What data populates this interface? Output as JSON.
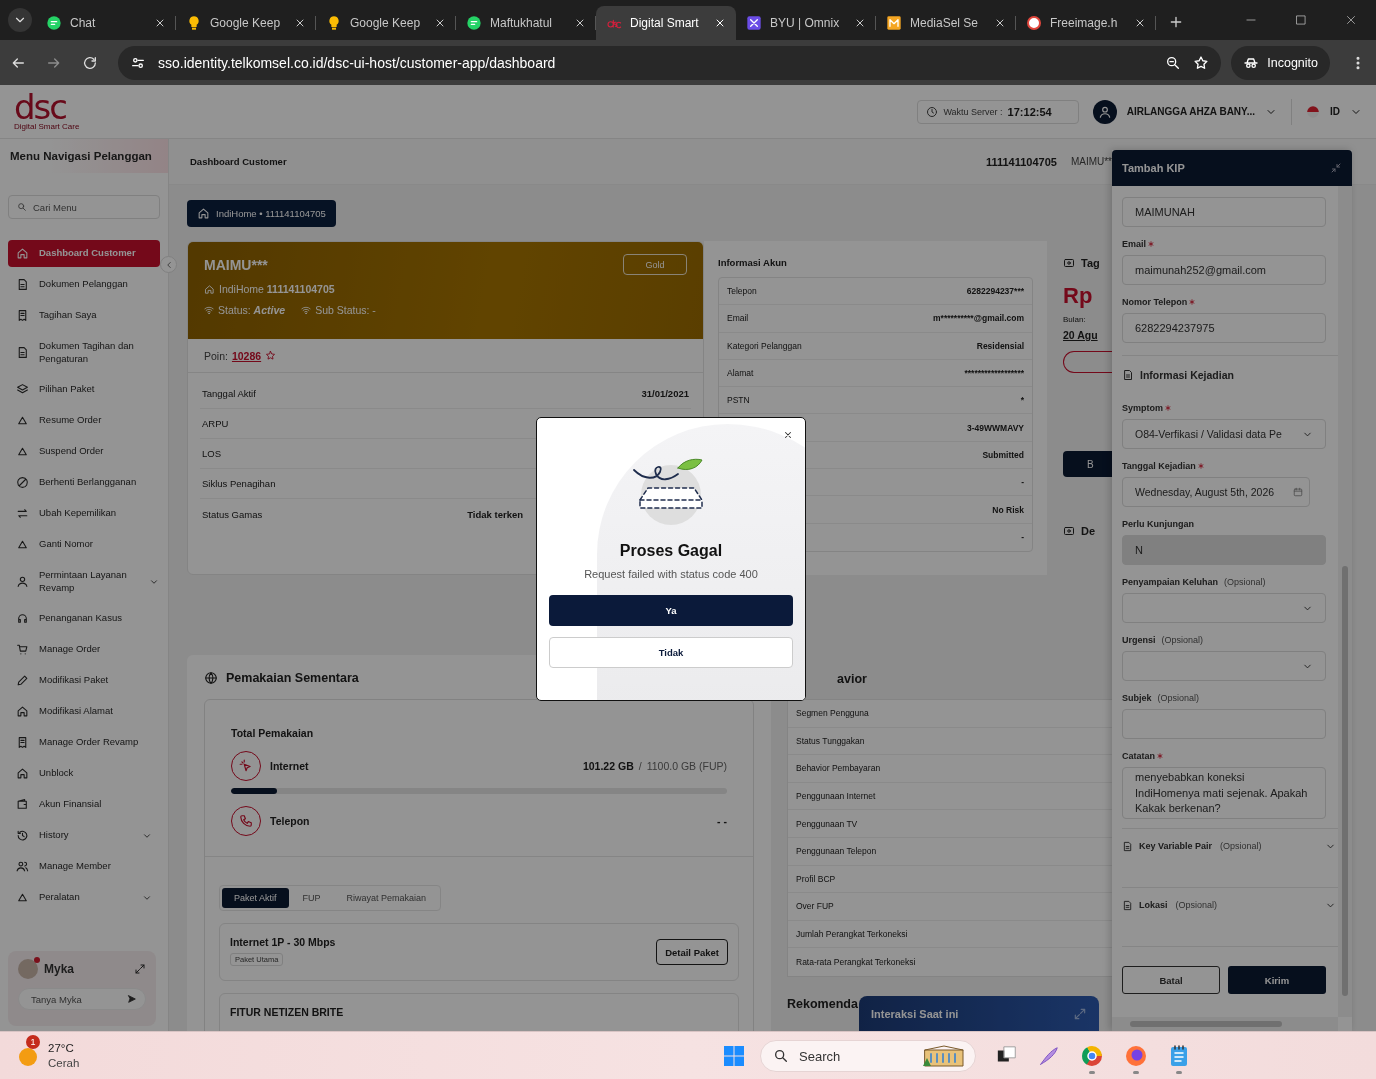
{
  "browser": {
    "tabs": [
      {
        "title": "Chat",
        "selected": false
      },
      {
        "title": "Google Keep",
        "selected": false
      },
      {
        "title": "Google Keep",
        "selected": false
      },
      {
        "title": "Maftukhatul",
        "selected": false
      },
      {
        "title": "Digital Smart",
        "selected": true
      },
      {
        "title": "BYU | Omnix",
        "selected": false
      },
      {
        "title": "MediaSel Se",
        "selected": false
      },
      {
        "title": "Freeimage.h",
        "selected": false
      }
    ],
    "url": "sso.identity.telkomsel.co.id/dsc-ui-host/customer-app/dashboard",
    "profile": "Incognito"
  },
  "header": {
    "logo": "dsc",
    "logo_tagline": "Digital Smart Care",
    "server_time_label": "Waktu Server :",
    "server_time": "17:12:54",
    "user": "AIRLANGGA AHZA BANY...",
    "language": "ID"
  },
  "sidebar": {
    "title": "Menu Navigasi Pelanggan",
    "search_placeholder": "Cari Menu",
    "items": [
      {
        "label": "Dashboard Customer",
        "selected": true,
        "expandable": false
      },
      {
        "label": "Dokumen Pelanggan",
        "selected": false,
        "expandable": false
      },
      {
        "label": "Tagihan Saya",
        "selected": false,
        "expandable": false
      },
      {
        "label": "Dokumen Tagihan dan Pengaturan",
        "selected": false,
        "expandable": false
      },
      {
        "label": "Pilihan Paket",
        "selected": false,
        "expandable": false
      },
      {
        "label": "Resume Order",
        "selected": false,
        "expandable": false
      },
      {
        "label": "Suspend Order",
        "selected": false,
        "expandable": false
      },
      {
        "label": "Berhenti Berlangganan",
        "selected": false,
        "expandable": false
      },
      {
        "label": "Ubah Kepemilikan",
        "selected": false,
        "expandable": false
      },
      {
        "label": "Ganti Nomor",
        "selected": false,
        "expandable": false
      },
      {
        "label": "Permintaan Layanan Revamp",
        "selected": false,
        "expandable": true
      },
      {
        "label": "Penanganan Kasus",
        "selected": false,
        "expandable": false
      },
      {
        "label": "Manage Order",
        "selected": false,
        "expandable": false
      },
      {
        "label": "Modifikasi Paket",
        "selected": false,
        "expandable": false
      },
      {
        "label": "Modifikasi Alamat",
        "selected": false,
        "expandable": false
      },
      {
        "label": "Manage Order Revamp",
        "selected": false,
        "expandable": false
      },
      {
        "label": "Unblock",
        "selected": false,
        "expandable": false
      },
      {
        "label": "Akun Finansial",
        "selected": false,
        "expandable": false
      },
      {
        "label": "History",
        "selected": false,
        "expandable": true
      },
      {
        "label": "Manage Member",
        "selected": false,
        "expandable": false
      },
      {
        "label": "Peralatan",
        "selected": false,
        "expandable": true
      }
    ],
    "assistant": {
      "name": "Myka",
      "placeholder": "Tanya Myka"
    }
  },
  "breadcrumb": {
    "title": "Dashboard Customer",
    "number": "111141104705",
    "name": "MAIMU**"
  },
  "account_chip": "IndiHome • 111141104705",
  "customer_card": {
    "name": "MAIMU***",
    "tier": "Gold",
    "service": "IndiHome **111141104705**",
    "status": "Status: *Active*",
    "sub_status": "Sub Status: -",
    "points_label": "Poin:",
    "points": "10286"
  },
  "customer_details": [
    {
      "label": "Tanggal Aktif",
      "value": "31/01/2021"
    },
    {
      "label": "ARPU"
    },
    {
      "label": "LOS"
    },
    {
      "label": "Siklus Penagihan"
    },
    {
      "label": "Status Gamas",
      "value": "Tidak terken"
    }
  ],
  "account_info": {
    "title": "Informasi Akun",
    "rows": [
      {
        "label": "Telepon",
        "value": "6282294237***"
      },
      {
        "label": "Email",
        "value": "m**********@gmail.com"
      },
      {
        "label": "Kategori Pelanggan",
        "value": "Residensial"
      },
      {
        "label": "Alamat",
        "value": "******************"
      },
      {
        "label": "PSTN",
        "value": "*"
      },
      {
        "value": "3-49WWMAVY"
      },
      {
        "value": "Submitted"
      },
      {
        "value": "-"
      },
      {
        "value": "No Risk"
      },
      {
        "value": "-"
      }
    ]
  },
  "billing_peek": {
    "title": "Tag",
    "amount": "Rp",
    "month_label": "Bulan:",
    "month": "20 Agu",
    "button": "B",
    "section": "De"
  },
  "usage": {
    "title": "Pemakaian Sementara",
    "total_title": "Total Pemakaian",
    "items": [
      {
        "kind": "internet",
        "label": "Internet",
        "used": "101.22 GB",
        "separator": "/",
        "quota": "1100.0 GB (FUP)",
        "level": 0.092
      },
      {
        "kind": "phone",
        "label": "Telepon",
        "used": "- -"
      }
    ],
    "tabs": [
      {
        "label": "Paket Aktif",
        "selected": true
      },
      {
        "label": "FUP",
        "selected": false
      },
      {
        "label": "Riwayat Pemakaian",
        "selected": false
      }
    ],
    "packages": [
      {
        "name": "Internet 1P - 30 Mbps",
        "tag": "Paket Utama",
        "button": "Detail Paket"
      },
      {
        "name": "FITUR NETIZEN BRITE"
      }
    ]
  },
  "behavior": {
    "title": "avior",
    "rows": [
      "Segmen Pengguna",
      "Status Tunggakan",
      "Behavior Pembayaran",
      "Penggunaan Internet",
      "Penggunaan TV",
      "Penggunaan Telepon",
      "Profil BCP",
      "Over FUP",
      "Jumlah Perangkat Terkoneksi",
      "Rata-rata Perangkat Terkoneksi"
    ]
  },
  "recommendation_title": "Rekomenda",
  "interaction_bar": "Interaksi Saat ini",
  "kip_panel": {
    "title": "Tambah KIP",
    "fields": [
      {
        "kind": "text",
        "value": "MAIMUNAH"
      },
      {
        "kind": "text",
        "label": "Email",
        "required": true,
        "value": "maimunah252@gmail.com"
      },
      {
        "kind": "text",
        "label": "Nomor Telepon",
        "required": true,
        "value": "6282294237975"
      },
      {
        "kind": "section",
        "label": "Informasi Kejadian"
      },
      {
        "kind": "select",
        "label": "Symptom",
        "required": true,
        "value": "O84-Verfikasi / Validasi data Pe"
      },
      {
        "kind": "date",
        "label": "Tanggal Kejadian",
        "required": true,
        "value": "Wednesday, August 5th, 2026"
      },
      {
        "kind": "text",
        "label": "Perlu Kunjungan",
        "required": false,
        "value": "N",
        "disabled": true
      },
      {
        "kind": "select",
        "label": "Penyampaian Keluhan",
        "required": false,
        "optional_note": "(Opsional)"
      },
      {
        "kind": "select",
        "label": "Urgensi",
        "required": false,
        "optional_note": "(Opsional)"
      },
      {
        "kind": "text",
        "label": "Subjek",
        "required": false,
        "optional_note": "(Opsional)"
      },
      {
        "kind": "textarea",
        "label": "Catatan",
        "required": true,
        "value": "menyebabkan koneksi IndiHomenya mati sejenak. Apakah Kakak berkenan?"
      },
      {
        "kind": "collapsible",
        "label": "Key Variable Pair",
        "optional_note": "(Opsional)",
        "expanded": false
      },
      {
        "kind": "collapsible",
        "label": "Lokasi",
        "optional_note": "(Opsional)",
        "expanded": false
      }
    ],
    "buttons": [
      {
        "label": "Batal",
        "kind": "secondary"
      },
      {
        "label": "Kirim",
        "kind": "primary"
      }
    ]
  },
  "modal": {
    "title": "Proses Gagal",
    "message": "Request failed with status code 400",
    "buttons": [
      {
        "label": "Ya",
        "kind": "primary"
      },
      {
        "label": "Tidak",
        "kind": "secondary"
      }
    ]
  },
  "taskbar": {
    "weather_badge": "1",
    "temperature": "27°C",
    "condition": "Cerah",
    "search_placeholder": "Search"
  }
}
